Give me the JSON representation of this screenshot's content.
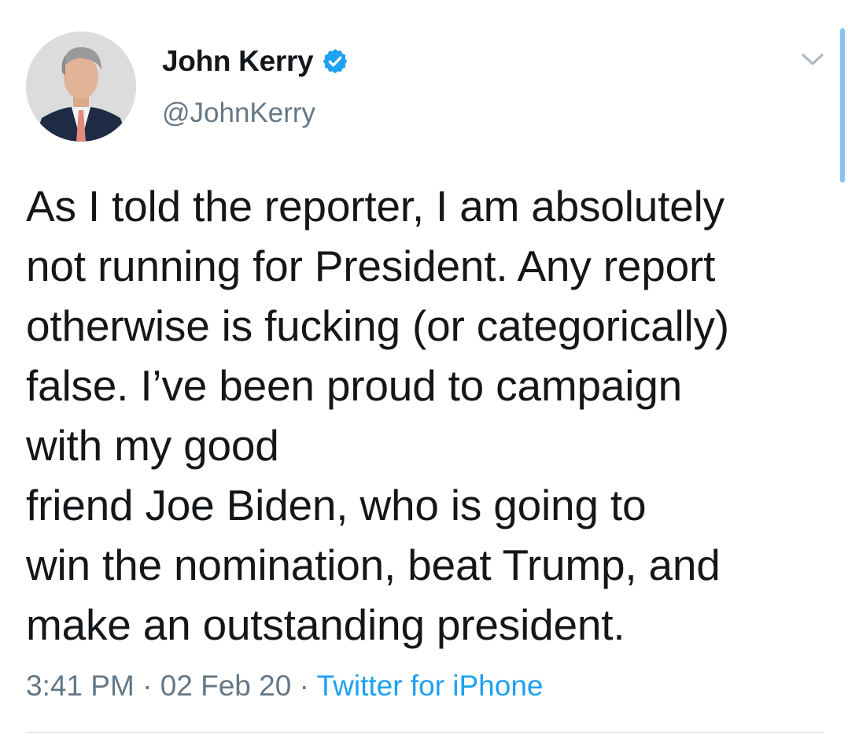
{
  "author": {
    "display_name": "John Kerry",
    "handle": "@JohnKerry",
    "verified": true
  },
  "tweet": {
    "lines": [
      "As I told the reporter, I am absolutely",
      "not running for President. Any report",
      "otherwise is fucking (or categorically)",
      "false. I’ve been proud to campaign",
      "with my good",
      "friend Joe Biden, who is going to",
      "win the nomination, beat Trump, and",
      "make an outstanding president."
    ]
  },
  "meta": {
    "time": "3:41 PM",
    "separator": "·",
    "date": "02 Feb 20",
    "source": "Twitter for iPhone"
  },
  "icons": {
    "verified": "verified-badge-icon",
    "menu": "chevron-down-icon"
  },
  "colors": {
    "text": "#14171a",
    "secondary": "#657786",
    "accent": "#1da1f2"
  }
}
